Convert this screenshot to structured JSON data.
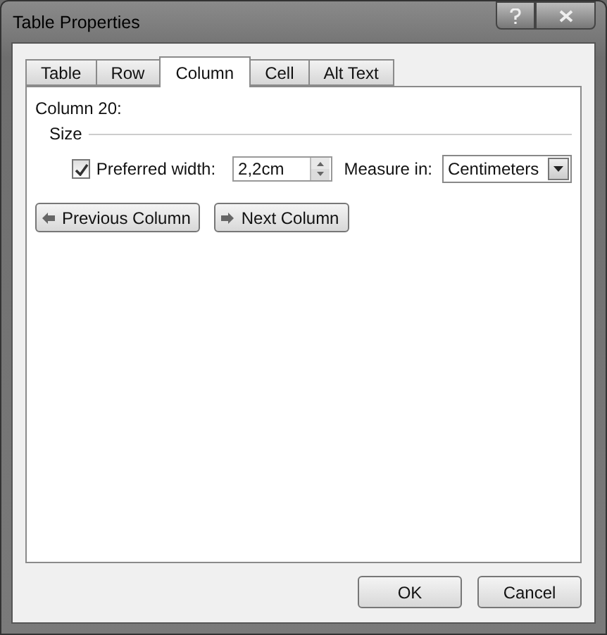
{
  "window": {
    "title": "Table Properties"
  },
  "tabs": [
    {
      "label": "Table",
      "selected": false
    },
    {
      "label": "Row",
      "selected": false
    },
    {
      "label": "Column",
      "selected": true
    },
    {
      "label": "Cell",
      "selected": false
    },
    {
      "label": "Alt Text",
      "selected": false
    }
  ],
  "column_label": "Column 20:",
  "size_group": {
    "title": "Size",
    "preferred_width": {
      "label": "Preferred width:",
      "checked": true,
      "value": "2,2cm"
    },
    "measure_in": {
      "label": "Measure in:",
      "value": "Centimeters"
    }
  },
  "nav_buttons": [
    "Previous Column",
    "Next Column"
  ],
  "buttons": [
    "OK",
    "Cancel"
  ]
}
